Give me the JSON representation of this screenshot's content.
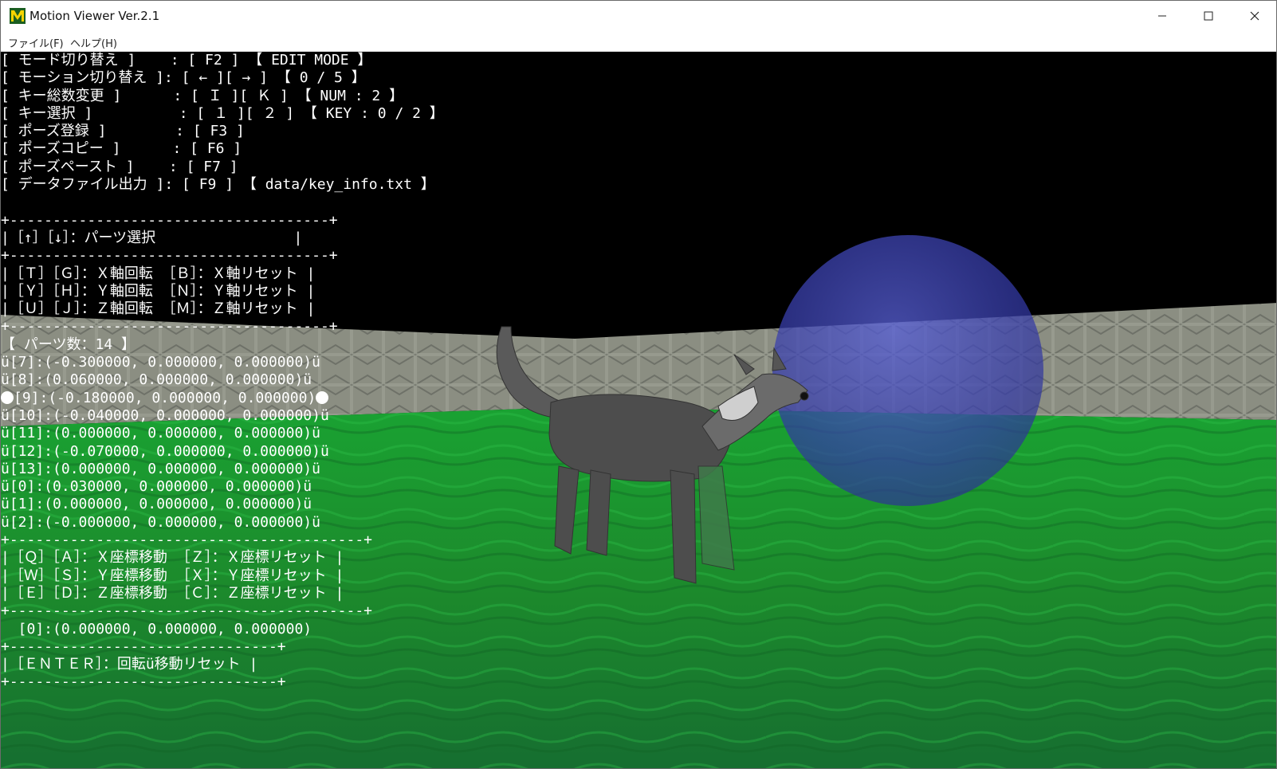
{
  "window": {
    "title": "Motion Viewer Ver.2.1",
    "icon": "m-logo-icon",
    "controls": [
      "minimize-icon",
      "maximize-icon",
      "close-icon"
    ]
  },
  "menu": {
    "items": [
      {
        "label": "ファイル(F)"
      },
      {
        "label": "ヘルプ(H)"
      }
    ]
  },
  "hud": {
    "controls": [
      "[ モード切り替え ]    : [ F2 ] 【 EDIT MODE 】",
      "[ モーション切り替え ]: [ ← ][ → ] 【 0 / 5 】",
      "[ キー総数変更 ]      : [ Ｉ ][ Ｋ ] 【 NUM : 2 】",
      "[ キー選択 ]          : [ １ ][ ２ ] 【 KEY : 0 / 2 】",
      "[ ポーズ登録 ]        : [ F3 ]",
      "[ ポーズコピー ]      : [ F6 ]",
      "[ ポーズペースト ]    : [ F7 ]",
      "[ データファイル出力 ]: [ F9 ] 【 data/key_info.txt 】"
    ],
    "rotation_box": [
      "+-------------------------------------+",
      "|［↑］［↓］：パーツ選択                |",
      "+-------------------------------------+",
      "|［Ｔ］［Ｇ］：Ｘ軸回転 ［Ｂ］：Ｘ軸リセット |",
      "|［Ｙ］［Ｈ］：Ｙ軸回転 ［Ｎ］：Ｙ軸リセット |",
      "|［Ｕ］［Ｊ］：Ｚ軸回転 ［Ｍ］：Ｚ軸リセット |",
      "+-------------------------------------+"
    ],
    "parts_count": "【 パーツ数：14 】",
    "parts": [
      "ü[7]:(-0.300000, 0.000000, 0.000000)ü",
      "ü[8]:(0.060000, 0.000000, 0.000000)ü",
      "[9]:(-0.180000, 0.000000, 0.000000)",
      "ü[10]:(-0.040000, 0.000000, 0.000000)ü",
      "ü[11]:(0.000000, 0.000000, 0.000000)ü",
      "ü[12]:(-0.070000, 0.000000, 0.000000)ü",
      "ü[13]:(0.000000, 0.000000, 0.000000)ü",
      "ü[0]:(0.030000, 0.000000, 0.000000)ü",
      "ü[1]:(0.000000, 0.000000, 0.000000)ü",
      "ü[2]:(-0.000000, 0.000000, 0.000000)ü"
    ],
    "selected_part_index": 2,
    "position_box": [
      "+-----------------------------------------+",
      "|［Ｑ］［Ａ］：Ｘ座標移動 ［Ｚ］：Ｘ座標リセット |",
      "|［Ｗ］［Ｓ］：Ｙ座標移動 ［Ｘ］：Ｙ座標リセット |",
      "|［Ｅ］［Ｄ］：Ｚ座標移動 ［Ｃ］：Ｚ座標リセット |",
      "+-----------------------------------------+"
    ],
    "position_value": "  [0]:(0.000000, 0.000000, 0.000000)",
    "reset_box": [
      "+-------------------------------+",
      "|［ＥＮＴＥＲ］：回転ü移動リセット |",
      "+-------------------------------+"
    ]
  },
  "colors": {
    "floor": "#1f8f2e",
    "wall": "#8a8d80",
    "sphere": "#3a3fb8",
    "wolf": "#4a4a4a",
    "sky": "#000000"
  }
}
